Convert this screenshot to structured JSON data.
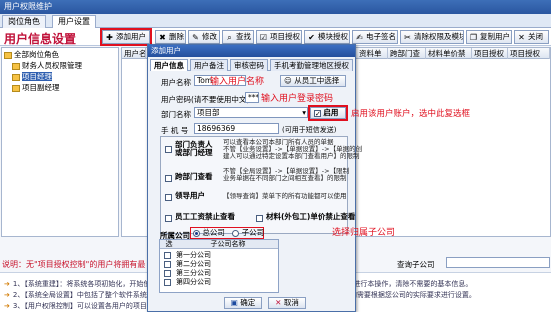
{
  "window": {
    "title": "用户权限维护",
    "tabs": [
      "岗位角色",
      "用户设置"
    ]
  },
  "page_title": "用户信息设置",
  "toolbar": [
    {
      "label": "添加用户",
      "icon": "✚",
      "name": "add-user-button"
    },
    {
      "label": "删除",
      "icon": "✖",
      "name": "delete-button"
    },
    {
      "label": "修改",
      "icon": "✎",
      "name": "edit-button"
    },
    {
      "label": "查找",
      "icon": "⌕",
      "name": "find-button"
    },
    {
      "label": "项目授权",
      "icon": "☑",
      "name": "project-auth-button"
    },
    {
      "label": "模块授权",
      "icon": "✔",
      "name": "module-auth-button"
    },
    {
      "label": "电子签名",
      "icon": "✍",
      "name": "e-signature-button"
    },
    {
      "label": "清除权限及模块",
      "icon": "✂",
      "name": "clear-permissions-button"
    },
    {
      "label": "复制用户",
      "icon": "❐",
      "name": "copy-user-button"
    },
    {
      "label": "关闭",
      "icon": "✕",
      "name": "close-button"
    }
  ],
  "tree": [
    {
      "label": "全部岗位角色",
      "level": 0
    },
    {
      "label": "财务人员权限管理",
      "level": 1
    },
    {
      "label": "项目经理",
      "level": 1,
      "selected": true
    },
    {
      "label": "项目副经理",
      "level": 1
    }
  ],
  "grid_headers": [
    "用户名",
    "用户",
    "资料单",
    "跨部门查看",
    "材料单价禁止",
    "项目授权",
    "项目授权2",
    "项目授权3"
  ],
  "grid_headers_right": [
    "资料单",
    "跨部门查",
    "材料单价禁",
    "项目授权",
    "项目授权",
    "项目授权"
  ],
  "note": "说明：无\"项目授权控制\"的用户将拥有最",
  "query_label": "查询子公司",
  "help_lines": [
    "1、【系统重建】：将系统各项初始化，开始使用本软件前，需要先对各部门，岗位角色以及用户设置完毕后，再进行本操作，清除不需要的基本信息。",
    "2、【系统全局设置】中包括了整个软件系统的核心设置，请谨慎操作，设置完毕后需要重新登录使系统生效，如需要根据您公司的实际要求进行设置。",
    "3、【用户权限控制】可以设置各用户的项目授权及模块授权。"
  ],
  "dialog": {
    "title": "添加用户",
    "tabs": [
      "用户信息",
      "用户备注",
      "审核密码",
      "手机考勤管理地区授权"
    ],
    "username_label": "用户名称",
    "username_value": "Tom",
    "username_hint": "输入用户名称",
    "select_employee_button": "从员工中选择",
    "password_label": "用户密码(请不要使用中文)",
    "password_value": "***",
    "password_hint": "输入用户登录密码",
    "dept_label": "部门名称",
    "dept_value": "项目部",
    "enable_label": "启用",
    "enable_hint": "启用该用户账户，选中此复选框",
    "phone_label": "手 机 号",
    "phone_value": "18696369",
    "phone_note": "(可用于短信发送)",
    "permissions": [
      {
        "title": "部门负责人\n或部门经理",
        "desc": "可以查看本公司本部门所有人员的单据\n不管【业务设置】->【单据设置】->【单据的创\n建人可以通过特定设置本部门查看用户】的限制"
      },
      {
        "title": "跨部门查看",
        "desc": "不管【全局设置】->【单据设置】->【限制\n业务单据在不同部门之间相互查看】的限制"
      },
      {
        "title": "领导用户",
        "desc": "【领导查询】菜单下的所有功能都可以使用"
      },
      {
        "title": "员工工资禁止查看",
        "desc": ""
      },
      {
        "title": "材料(外包工)单价禁止查看",
        "desc": ""
      }
    ],
    "company_label": "所属公司",
    "company_options": [
      "总公司",
      "子公司"
    ],
    "company_selected": "总公司",
    "company_hint": "选择归属子公司",
    "sub_table_headers": [
      "选",
      "子公司名称"
    ],
    "sub_companies": [
      "第一分公司",
      "第二分公司",
      "第三分公司",
      "第四分公司"
    ],
    "ok_button": "确定",
    "cancel_button": "取消"
  },
  "colors": {
    "title_bar": "#2a56a0",
    "accent_red": "#e0101f",
    "heading_red": "#c0123a"
  }
}
